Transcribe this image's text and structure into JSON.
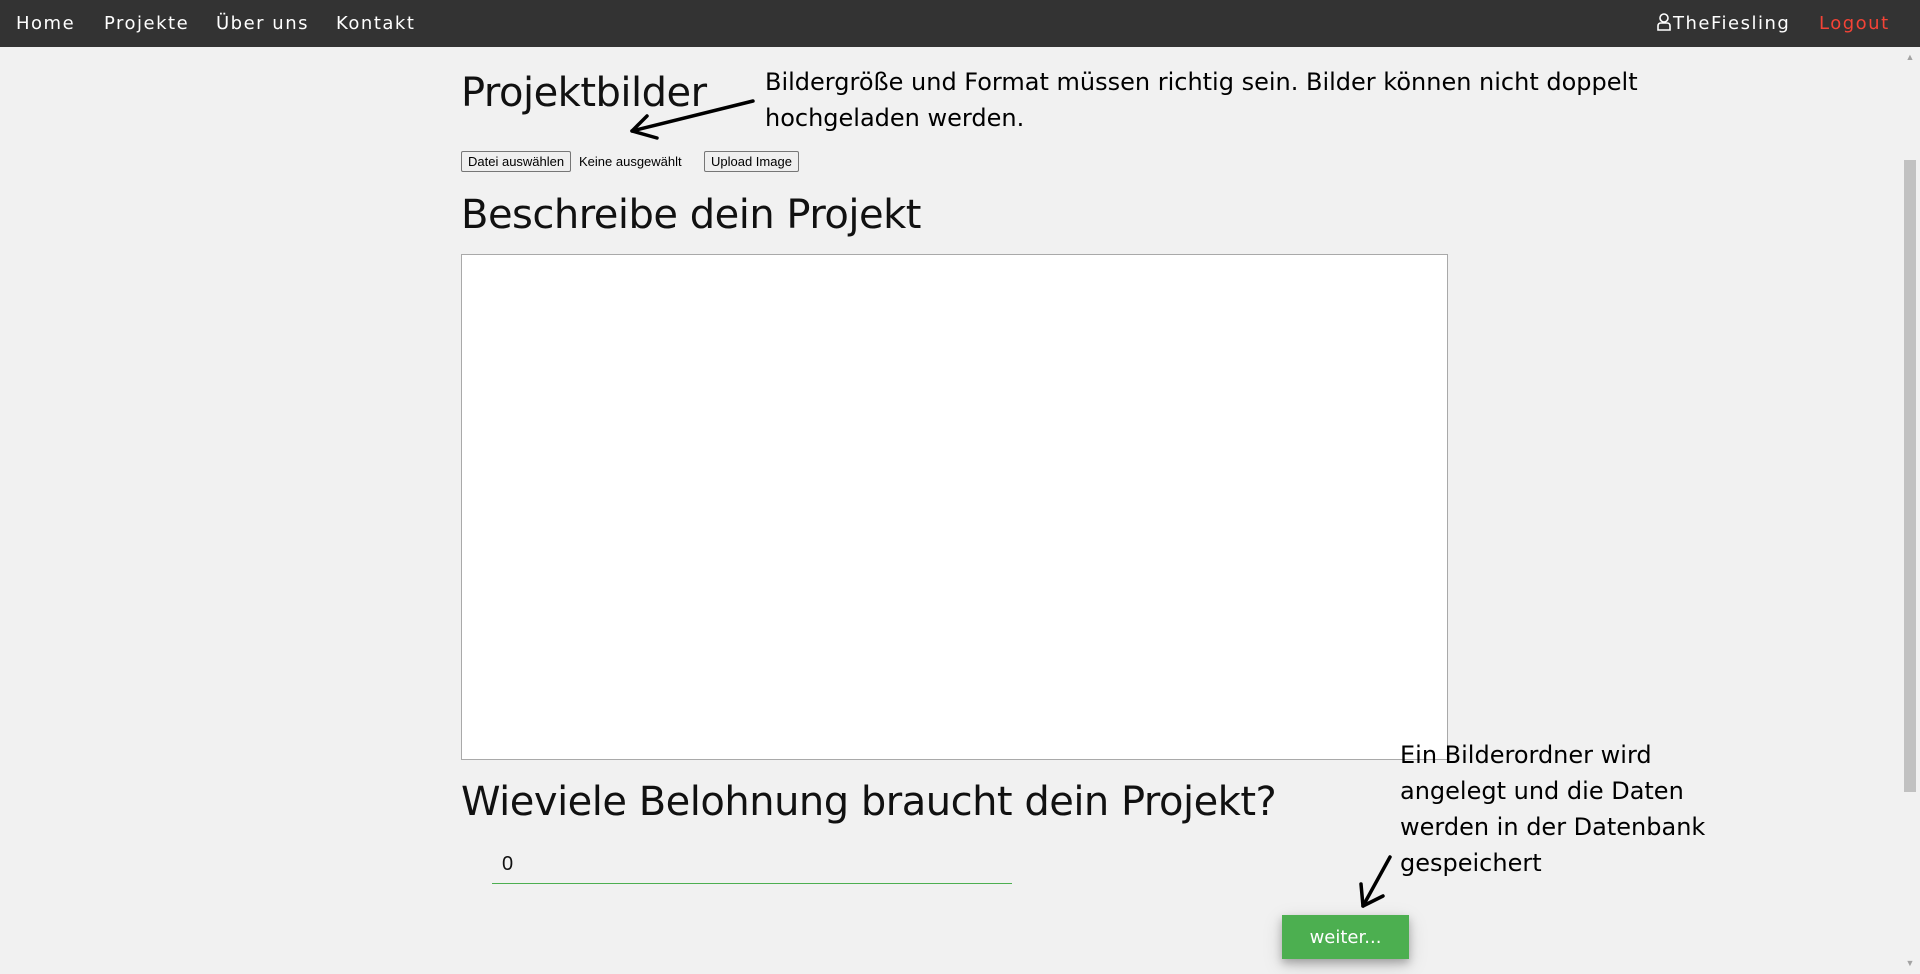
{
  "nav": {
    "home": "Home",
    "projekte": "Projekte",
    "ueber_uns": "Über uns",
    "kontakt": "Kontakt",
    "user": "TheFiesling",
    "logout": "Logout"
  },
  "colors": {
    "navbar": "#333333",
    "logout": "#f44336",
    "accent_green": "#4caf50"
  },
  "icons": {
    "user": "user-icon"
  },
  "form": {
    "images_heading": "Projektbilder",
    "file_button": "Datei auswählen",
    "file_status": "Keine ausgewählt",
    "upload_button": "Upload Image",
    "description_heading": "Beschreibe dein Projekt",
    "description_value": "",
    "reward_heading": "Wieviele Belohnung braucht dein Projekt?",
    "reward_value": "0",
    "submit_button": "weiter..."
  },
  "annotations": {
    "images_note_line1": "Bildergröße und Format müssen richtig sein. Bilder können nicht doppelt",
    "images_note_line2": "hochgeladen werden.",
    "submit_note_line1": "Ein Bilderordner wird",
    "submit_note_line2": "angelegt und die Daten",
    "submit_note_line3": "werden in der Datenbank",
    "submit_note_line4": "gespeichert"
  }
}
